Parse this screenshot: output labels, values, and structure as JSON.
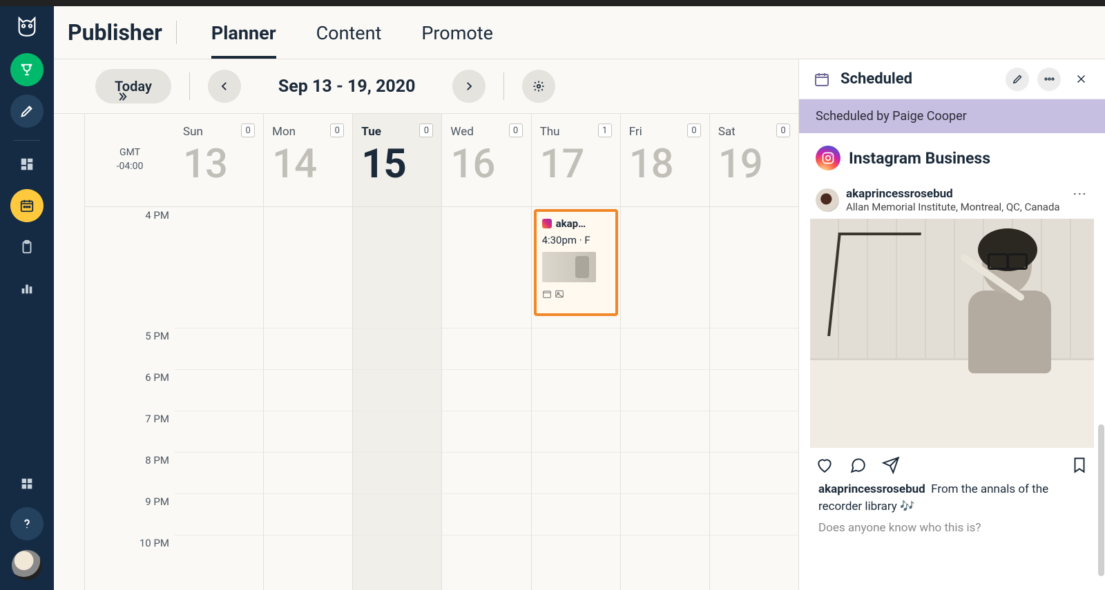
{
  "header": {
    "page_title": "Publisher",
    "tabs": [
      {
        "label": "Planner",
        "active": true
      },
      {
        "label": "Content",
        "active": false
      },
      {
        "label": "Promote",
        "active": false
      }
    ]
  },
  "toolbar": {
    "today_label": "Today",
    "date_range": "Sep 13 - 19, 2020"
  },
  "timezone": {
    "label": "GMT",
    "offset": "-04:00"
  },
  "days": [
    {
      "name": "Sun",
      "num": "13",
      "count": "0",
      "today": false
    },
    {
      "name": "Mon",
      "num": "14",
      "count": "0",
      "today": false
    },
    {
      "name": "Tue",
      "num": "15",
      "count": "0",
      "today": true
    },
    {
      "name": "Wed",
      "num": "16",
      "count": "0",
      "today": false
    },
    {
      "name": "Thu",
      "num": "17",
      "count": "1",
      "today": false
    },
    {
      "name": "Fri",
      "num": "18",
      "count": "0",
      "today": false
    },
    {
      "name": "Sat",
      "num": "19",
      "count": "0",
      "today": false
    }
  ],
  "hours": [
    "4 PM",
    "5 PM",
    "6 PM",
    "7 PM",
    "8 PM",
    "9 PM",
    "10 PM"
  ],
  "event": {
    "user_short": "akap…",
    "time_row": "4:30pm · F"
  },
  "detail": {
    "status": "Scheduled",
    "scheduled_by": "Scheduled by Paige Cooper",
    "network": "Instagram Business",
    "post_user": "akaprincessrosebud",
    "post_location": "Allan Memorial Institute, Montreal, QC, Canada",
    "caption_user": "akaprincessrosebud",
    "caption_text": "From the annals of the recorder library 🎶",
    "caption_question": "Does anyone know who this is?"
  }
}
